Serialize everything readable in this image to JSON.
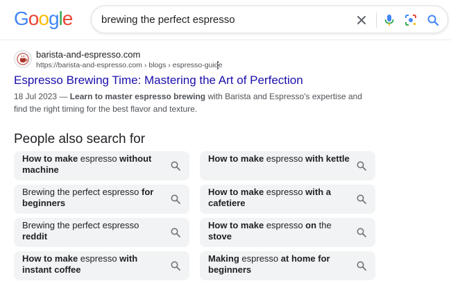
{
  "header": {
    "logo": "Google",
    "logo_colors": [
      "#4285F4",
      "#EA4335",
      "#FBBC05",
      "#4285F4",
      "#34A853",
      "#EA4335"
    ],
    "search_query": "brewing the perfect espresso",
    "icons": [
      "clear-icon",
      "microphone-icon",
      "lens-icon",
      "search-icon"
    ]
  },
  "result": {
    "site_name": "barista-and-espresso.com",
    "url": "https://barista-and-espresso.com › blogs › espresso-guide",
    "title": "Espresso Brewing Time: Mastering the Art of Perfection",
    "title_color": "#1a0dab",
    "snippet_parts": [
      {
        "text": "18 Jul 2023 — ",
        "bold": false
      },
      {
        "text": "Learn to master espresso brewing",
        "bold": true
      },
      {
        "text": " with Barista and Espresso's expertise and find the right timing for the best flavor and texture.",
        "bold": false
      }
    ]
  },
  "pasf": {
    "heading": "People also search for",
    "items": [
      [
        {
          "t": "How to make",
          "b": true
        },
        {
          "t": " espresso ",
          "b": false
        },
        {
          "t": "without machine",
          "b": true
        }
      ],
      [
        {
          "t": "How to make",
          "b": true
        },
        {
          "t": " espresso ",
          "b": false
        },
        {
          "t": "with kettle",
          "b": true
        }
      ],
      [
        {
          "t": "Brewing the perfect espresso ",
          "b": false
        },
        {
          "t": "for beginners",
          "b": true
        }
      ],
      [
        {
          "t": "How to make",
          "b": true
        },
        {
          "t": " espresso ",
          "b": false
        },
        {
          "t": "with a cafetiere",
          "b": true
        }
      ],
      [
        {
          "t": "Brewing the perfect espresso ",
          "b": false
        },
        {
          "t": "reddit",
          "b": true
        }
      ],
      [
        {
          "t": "How to make",
          "b": true
        },
        {
          "t": " espresso ",
          "b": false
        },
        {
          "t": "on",
          "b": true
        },
        {
          "t": " the ",
          "b": false
        },
        {
          "t": "stove",
          "b": true
        }
      ],
      [
        {
          "t": "How to make",
          "b": true
        },
        {
          "t": " espresso ",
          "b": false
        },
        {
          "t": "with instant coffee",
          "b": true
        }
      ],
      [
        {
          "t": "Making",
          "b": true
        },
        {
          "t": " espresso ",
          "b": false
        },
        {
          "t": "at home for beginners",
          "b": true
        }
      ]
    ]
  }
}
